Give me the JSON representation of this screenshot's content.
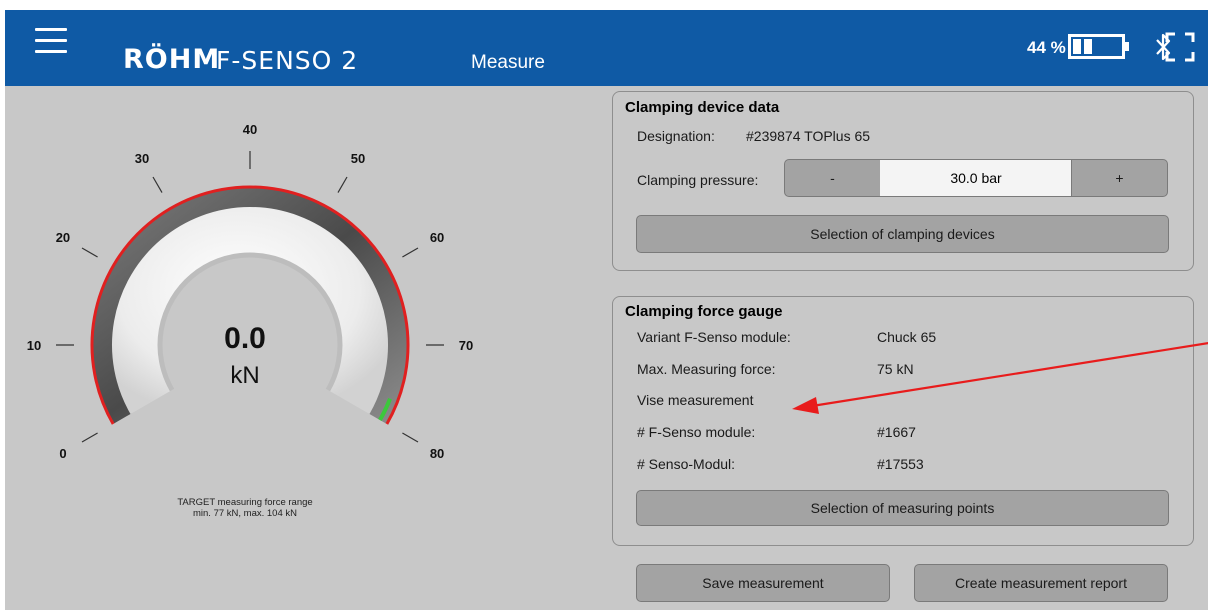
{
  "header": {
    "logo": "RÖHM",
    "product": "F-SENSO 2",
    "page_title": "Measure",
    "battery_percent": "44 %",
    "battery_level": 0.44
  },
  "gauge": {
    "value": "0.0",
    "unit": "kN",
    "ticks": [
      "0",
      "10",
      "20",
      "30",
      "40",
      "50",
      "60",
      "70",
      "80"
    ],
    "target_line1": "TARGET measuring force range",
    "target_line2": "min. 77 kN, max. 104 kN",
    "colors": {
      "range": "#e02020",
      "target": "#3cc83c"
    }
  },
  "clamping_device": {
    "title": "Clamping device data",
    "designation_label": "Designation:",
    "designation_value": "#239874 TOPlus 65",
    "pressure_label": "Clamping pressure:",
    "minus_label": "-",
    "pressure_value": "30.0 bar",
    "plus_label": "+",
    "selection_button": "Selection of clamping devices"
  },
  "force_gauge": {
    "title": "Clamping force gauge",
    "rows": [
      {
        "label": "Variant F-Senso module:",
        "value": "Chuck 65"
      },
      {
        "label": "Max. Measuring force:",
        "value": "75 kN"
      },
      {
        "label": "Vise measurement",
        "value": ""
      },
      {
        "label": "# F-Senso module:",
        "value": "#1667"
      },
      {
        "label": "# Senso-Modul:",
        "value": "#17553"
      }
    ],
    "selection_button": "Selection of measuring points"
  },
  "actions": {
    "save": "Save measurement",
    "report": "Create measurement report"
  }
}
